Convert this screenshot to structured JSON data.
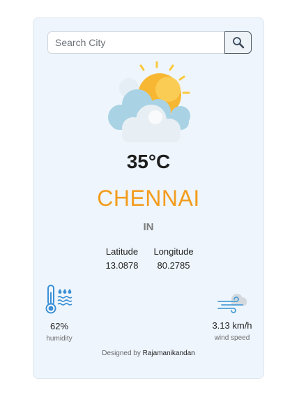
{
  "search": {
    "placeholder": "Search City",
    "value": ""
  },
  "icons": {
    "search": "magnifier-icon",
    "weather": "sun-behind-clouds-icon",
    "humidity": "thermometer-water-icon",
    "wind": "wind-cloud-icon"
  },
  "weather": {
    "temperature": "35°C",
    "city": "CHENNAI",
    "country": "IN"
  },
  "coordinates": {
    "latitude_label": "Latitude",
    "latitude_value": "13.0878",
    "longitude_label": "Longitude",
    "longitude_value": "80.2785"
  },
  "stats": {
    "humidity_value": "62%",
    "humidity_label": "humidity",
    "wind_value": "3.13 km/h",
    "wind_label": "wind speed"
  },
  "footer": {
    "prefix": "Designed by",
    "author": "Rajamanikandan"
  },
  "colors": {
    "card_bg": "#eef5fc",
    "city": "#f39c1d",
    "icon_blue": "#3a8fd6",
    "sun": "#f7b733"
  }
}
